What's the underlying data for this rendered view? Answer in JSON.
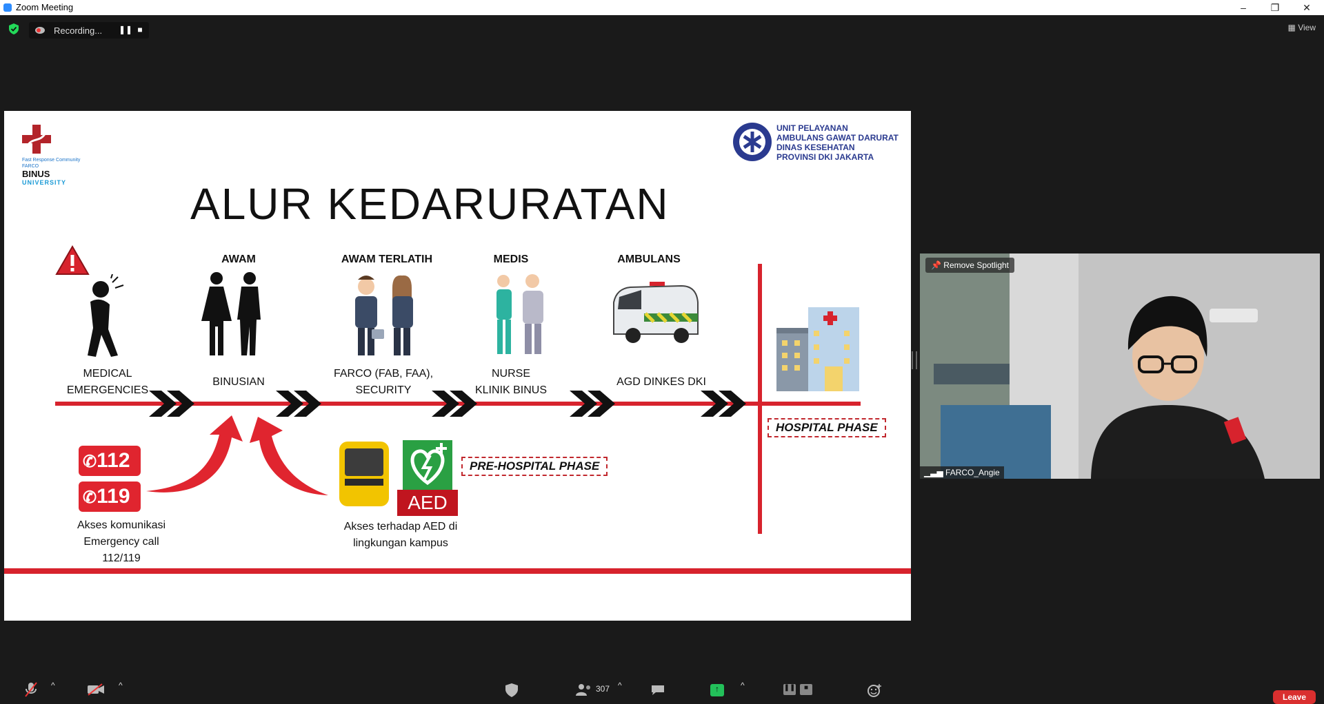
{
  "window": {
    "title": "Zoom Meeting"
  },
  "recording": {
    "label": "Recording..."
  },
  "view_label": "View",
  "slide": {
    "title": "ALUR KEDARURATAN",
    "brand": {
      "community": "Fast Response Community",
      "farco": "FARCO",
      "binus": "BINUS",
      "university": "UNIVERSITY"
    },
    "agency": [
      "UNIT PELAYANAN",
      "AMBULANS GAWAT DARURAT",
      "DINAS KESEHATAN",
      "PROVINSI DKI JAKARTA"
    ],
    "stages": [
      {
        "heading": "",
        "sub": [
          "MEDICAL",
          "EMERGENCIES"
        ]
      },
      {
        "heading": "AWAM",
        "sub": [
          "BINUSIAN"
        ]
      },
      {
        "heading": "AWAM TERLATIH",
        "sub": [
          "FARCO (FAB, FAA),",
          "SECURITY"
        ]
      },
      {
        "heading": "MEDIS",
        "sub": [
          "NURSE",
          "KLINIK BINUS"
        ]
      },
      {
        "heading": "AMBULANS",
        "sub": [
          "AGD DINKES DKI"
        ]
      }
    ],
    "phones": [
      "112",
      "119"
    ],
    "aed_label": "AED",
    "pre_hospital": "PRE-HOSPITAL PHASE",
    "hospital": "HOSPITAL PHASE",
    "caption_call": [
      "Akses komunikasi",
      "Emergency call",
      "112/119"
    ],
    "caption_aed": [
      "Akses terhadap AED di",
      "lingkungan kampus"
    ],
    "colors": {
      "red": "#d7232d",
      "navy": "#2a3a8f"
    }
  },
  "video": {
    "remove_spotlight": "Remove Spotlight",
    "participant": "FARCO_Angie"
  },
  "toolbar": {
    "participants_count": "307",
    "leave_label": "Leave"
  }
}
